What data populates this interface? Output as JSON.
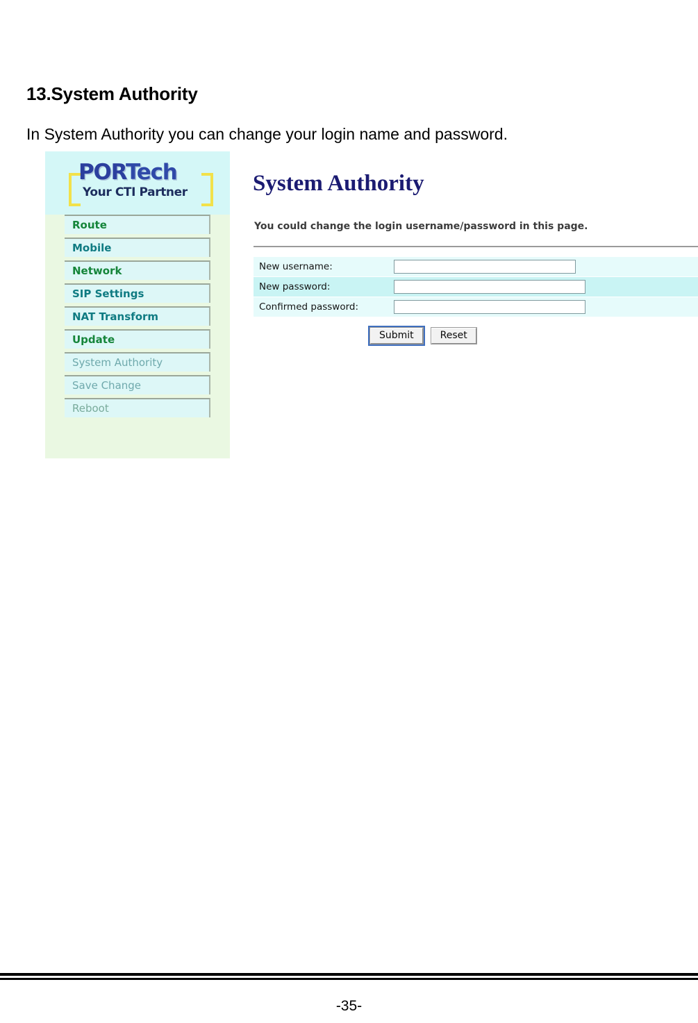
{
  "document": {
    "heading": "13.System Authority",
    "intro": "In System Authority you can change your login name and password.",
    "page_number": "-35-"
  },
  "screenshot": {
    "sidebar": {
      "logo": {
        "brand_primary": "POR",
        "brand_secondary": "Tech",
        "tagline": "Your CTI Partner",
        "brand_color": "#2b3f9e",
        "bracket_color": "#f2e14a",
        "background": "#d4f7f7"
      },
      "background": "#eaf8e2",
      "items": [
        {
          "label": "Route",
          "style": "bold-green",
          "color": "#15853a"
        },
        {
          "label": "Mobile",
          "style": "bold-teal",
          "color": "#0f7b82"
        },
        {
          "label": "Network",
          "style": "bold-green",
          "color": "#15853a"
        },
        {
          "label": "SIP Settings",
          "style": "bold-teal",
          "color": "#0f7b82"
        },
        {
          "label": "NAT Transform",
          "style": "bold-teal",
          "color": "#0f7b82"
        },
        {
          "label": "Update",
          "style": "bold-green",
          "color": "#15853a"
        },
        {
          "label": "System Authority",
          "style": "plain-teal",
          "color": "#6fa9ac"
        },
        {
          "label": "Save Change",
          "style": "plain-teal",
          "color": "#6fa9ac"
        },
        {
          "label": "Reboot",
          "style": "plain-gray",
          "color": "#79ab9b"
        }
      ]
    },
    "main": {
      "title": "System Authority",
      "title_color": "#1b1b72",
      "description": "You could change the login username/password in this page.",
      "form": {
        "rows": [
          {
            "label": "New username:",
            "value": "",
            "placeholder": "",
            "tint": "#e6fbfb"
          },
          {
            "label": "New password:",
            "value": "",
            "placeholder": "",
            "tint": "#c9f4f4"
          },
          {
            "label": "Confirmed password:",
            "value": "",
            "placeholder": "",
            "tint": "#e6fbfb"
          }
        ],
        "submit_label": "Submit",
        "reset_label": "Reset"
      }
    }
  }
}
